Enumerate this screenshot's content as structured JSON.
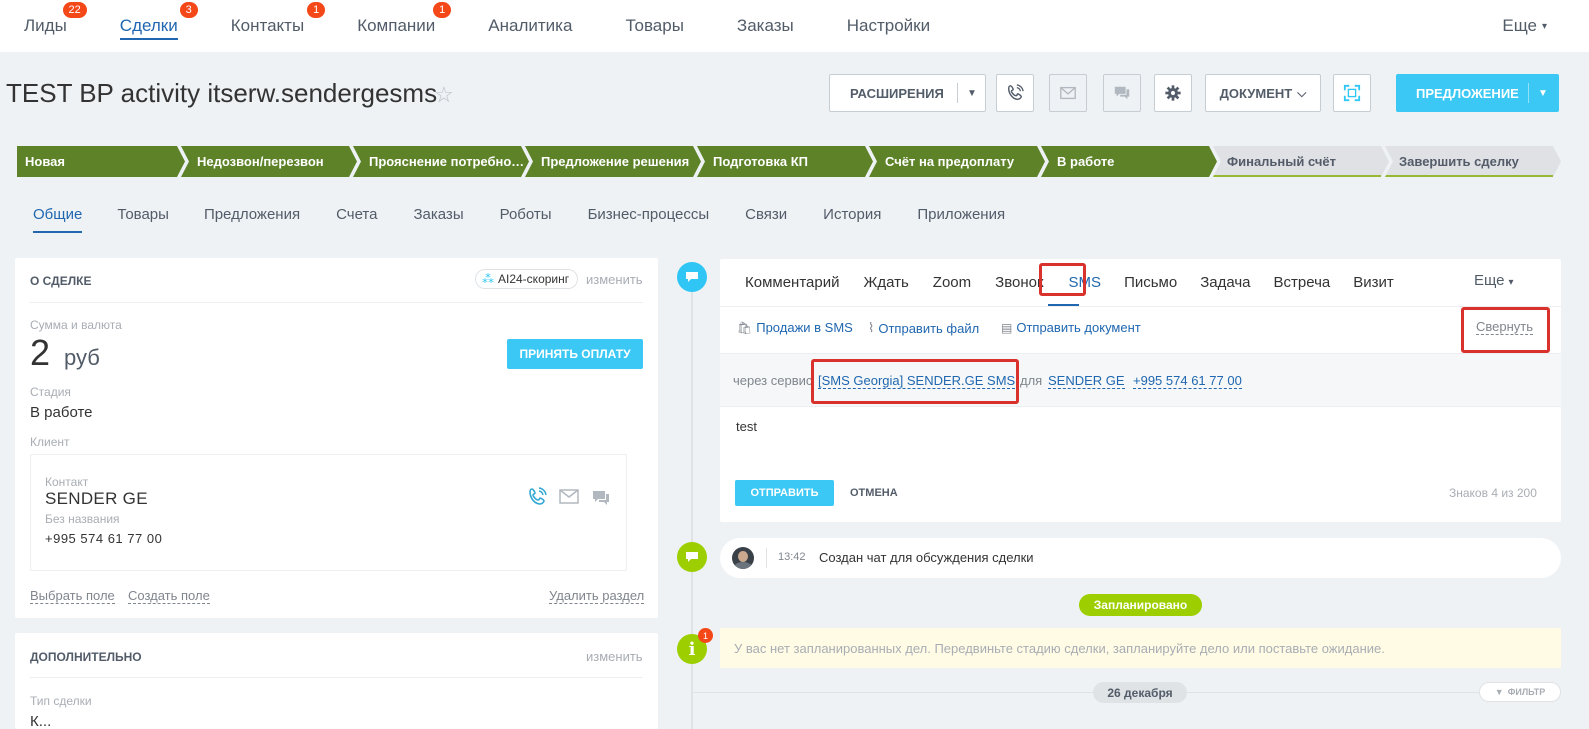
{
  "nav": {
    "items": [
      {
        "label": "Лиды",
        "badge": "22"
      },
      {
        "label": "Сделки",
        "badge": "3",
        "active": true
      },
      {
        "label": "Контакты",
        "badge": "1"
      },
      {
        "label": "Компании",
        "badge": "1"
      },
      {
        "label": "Аналитика",
        "badge": ""
      },
      {
        "label": "Товары",
        "badge": ""
      },
      {
        "label": "Заказы",
        "badge": ""
      },
      {
        "label": "Настройки",
        "badge": ""
      }
    ],
    "more": "Еще"
  },
  "deal": {
    "title": "TEST BP activity itserw.sendergesms"
  },
  "toolbar": {
    "extensions": "РАСШИРЕНИЯ",
    "document": "ДОКУМЕНТ",
    "proposal": "ПРЕДЛОЖЕНИЕ"
  },
  "stages": [
    {
      "label": "Новая",
      "done": true
    },
    {
      "label": "Недозвон/перезвон",
      "done": true
    },
    {
      "label": "Прояснение потребнос...",
      "done": true
    },
    {
      "label": "Предложение решения",
      "done": true
    },
    {
      "label": "Подготовка КП",
      "done": true
    },
    {
      "label": "Счёт на предоплату",
      "done": true
    },
    {
      "label": "В работе",
      "done": true
    },
    {
      "label": "Финальный счёт",
      "done": false
    },
    {
      "label": "Завершить сделку",
      "done": false
    }
  ],
  "tabs": [
    "Общие",
    "Товары",
    "Предложения",
    "Счета",
    "Заказы",
    "Роботы",
    "Бизнес-процессы",
    "Связи",
    "История",
    "Приложения"
  ],
  "about": {
    "header": "О СДЕЛКЕ",
    "scoring": "AI24-скоринг",
    "edit": "изменить",
    "sum_label": "Сумма и валюта",
    "sum_value": "2",
    "currency": "руб",
    "pay_button": "ПРИНЯТЬ ОПЛАТУ",
    "stage_label": "Стадия",
    "stage_value": "В работе",
    "client_label": "Клиент",
    "contact_label": "Контакт",
    "contact_name": "SENDER GE",
    "company": "Без названия",
    "phone": "+995 574 61 77 00",
    "choose_field": "Выбрать поле",
    "create_field": "Создать поле",
    "delete_section": "Удалить раздел"
  },
  "extra": {
    "header": "ДОПОЛНИТЕЛЬНО",
    "edit": "изменить",
    "type_label": "Тип сделки",
    "type_value": "К..."
  },
  "composer": {
    "tabs": [
      "Комментарий",
      "Ждать",
      "Zoom",
      "Звонок",
      "SMS",
      "Письмо",
      "Задача",
      "Встреча",
      "Визит"
    ],
    "more": "Еще",
    "actions": [
      "Продажи в SMS",
      "Отправить файл",
      "Отправить документ"
    ],
    "collapse": "Свернуть",
    "via": "через сервис",
    "service": "[SMS Georgia] SENDER.GE SMS",
    "for": "для",
    "recipient": "SENDER GE",
    "recipient_phone": "+995 574 61 77 00",
    "message": "test",
    "send": "ОТПРАВИТЬ",
    "cancel": "ОТМЕНА",
    "counter": "Знаков 4 из 200"
  },
  "timeline": {
    "event_time": "13:42",
    "event_text": "Создан чат для обсуждения сделки",
    "planned": "Запланировано",
    "notice_badge": "1",
    "notice": "У вас нет запланированных дел. Передвиньте стадию сделки, запланируйте дело или поставьте ожидание.",
    "date": "26 декабря",
    "filter": "ФИЛЬТР"
  },
  "colors": {
    "accent": "#2067b0",
    "cyan": "#3bc8f5",
    "stage_done": "#5d8228",
    "badge": "#f54819",
    "green_dot": "#9dcf00",
    "highlight": "#d9312b"
  }
}
